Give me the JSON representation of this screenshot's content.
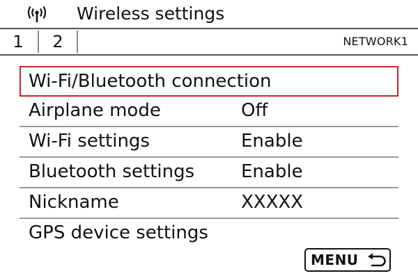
{
  "header": {
    "icon": "wireless-icon",
    "title": "Wireless settings"
  },
  "tabs": [
    {
      "label": "1"
    },
    {
      "label": "2",
      "selected": true
    }
  ],
  "network_name": "NETWORK1",
  "menu": [
    {
      "label": "Wi-Fi/Bluetooth connection",
      "value": "",
      "selected": true
    },
    {
      "label": "Airplane mode",
      "value": "Off"
    },
    {
      "label": "Wi-Fi settings",
      "value": "Enable"
    },
    {
      "label": "Bluetooth settings",
      "value": "Enable"
    },
    {
      "label": "Nickname",
      "value": "XXXXX"
    },
    {
      "label": "GPS device settings",
      "value": ""
    }
  ],
  "footer": {
    "button_label": "MENU",
    "icon": "return-icon"
  },
  "colors": {
    "selection_border": "#cc1f2b",
    "text": "#111111",
    "background": "#ffffff"
  }
}
